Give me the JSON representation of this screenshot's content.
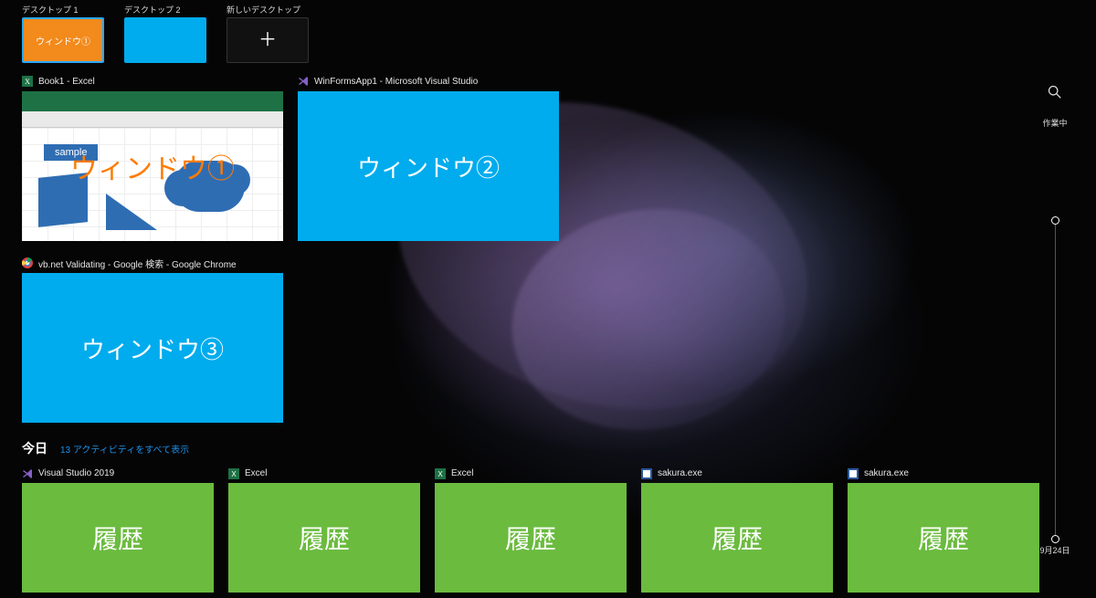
{
  "desktops": {
    "items": [
      {
        "label": "デスクトップ 1",
        "badge": "ウィンドウ①",
        "style": "orange",
        "active": true
      },
      {
        "label": "デスクトップ 2",
        "badge": "",
        "style": "blue",
        "active": false
      }
    ],
    "new_label": "新しいデスクトップ"
  },
  "windows": [
    {
      "title": "Book1 - Excel",
      "icon": "excel-icon",
      "overlay": "ウィンドウ①",
      "badge": "sample",
      "kind": "excel",
      "active": true
    },
    {
      "title": "WinFormsApp1 - Microsoft Visual Studio",
      "icon": "visual-studio-icon",
      "overlay": "ウィンドウ②",
      "kind": "plain",
      "active": false
    },
    {
      "title": "vb.net Validating - Google 検索 - Google Chrome",
      "icon": "chrome-icon",
      "overlay": "ウィンドウ③",
      "kind": "plain",
      "active": false
    }
  ],
  "timeline": {
    "heading": "今日",
    "more_label": "13 アクティビティをすべて表示",
    "rail": {
      "now": "作業中",
      "date": "9月24日"
    },
    "activities": [
      {
        "icon": "visual-studio-icon",
        "title": "Visual Studio 2019",
        "label": "履歴"
      },
      {
        "icon": "excel-icon",
        "title": "Excel",
        "label": "履歴"
      },
      {
        "icon": "excel-icon",
        "title": "Excel",
        "label": "履歴"
      },
      {
        "icon": "sakura-icon",
        "title": "sakura.exe",
        "label": "履歴"
      },
      {
        "icon": "sakura-icon",
        "title": "sakura.exe",
        "label": "履歴"
      }
    ]
  },
  "colors": {
    "accent_blue": "#00aced",
    "orange": "#f28a1c",
    "green": "#6bbb3f",
    "brand_orange": "#ff7b00"
  }
}
